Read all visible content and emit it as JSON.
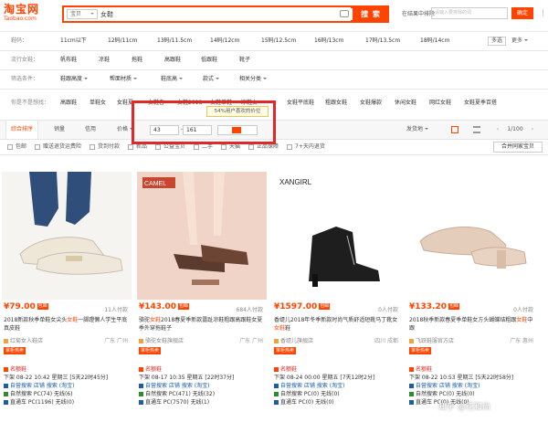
{
  "logo": {
    "line1": "淘宝网",
    "line2": "Taobao.com"
  },
  "search": {
    "scope": "宝贝",
    "value": "女鞋",
    "button": "搜 索",
    "in_result_label": "在结果中排除",
    "in_result_placeholder": "请输入要排除的词",
    "confirm": "确定"
  },
  "filters": {
    "size": {
      "label": "鞋码：",
      "items": [
        "11cm以下",
        "12码/11cm",
        "13码/11.5cm",
        "14码/12cm",
        "15码/12.5cm",
        "16码/13cm",
        "17码/13.5cm",
        "18码/14cm"
      ],
      "multi": "多选",
      "more": "更多"
    },
    "style": {
      "label": "流行女鞋：",
      "items": [
        "帆布鞋",
        "凉鞋",
        "拖鞋",
        "高跟鞋",
        "低跟鞋",
        "靴子"
      ]
    },
    "more_conditions": {
      "label": "筛选条件：",
      "items": [
        "鞋跟高度",
        "帮面材质",
        "鞋底高",
        "款式",
        "相关分类"
      ]
    },
    "maybe": {
      "label": "你是不是想找：",
      "items": [
        "高跟鞋",
        "单鞋女",
        "女鞋夏",
        "女鞋春",
        "女鞋2018",
        "女鞋单鞋",
        "凉鞋女",
        "女鞋平底鞋",
        "粗跟女鞋",
        "女鞋爆款",
        "休闲女鞋",
        "网红女鞋",
        "女鞋夏季百搭"
      ]
    }
  },
  "sort": {
    "items": [
      "综合排序",
      "销量",
      "信用",
      "价格"
    ],
    "price_from": "43",
    "price_to": "161",
    "shipping": "发货地",
    "view_pages": "1/100",
    "tip": "54%用户喜欢的价位"
  },
  "filter2": [
    "包邮",
    "赠送退货运费险",
    "货到付款",
    "新品",
    "公益宝贝",
    "二手",
    "天猫",
    "正品保障",
    "7+天内退货"
  ],
  "location": "合并同家宝贝",
  "products": [
    {
      "price": "¥79.00",
      "badge": "包邮",
      "paid": "11人付款",
      "title_pre": "2018新款秋季单鞋女尖头",
      "title_hl": "女鞋",
      "title_post": "一脚蹬懒人学生平底真皮鞋",
      "shop": "红菊女人鞋店",
      "city": "广东 广州",
      "tag": "掌柜热卖",
      "l1": "下架 08-22 10:42 星期三 [5天22时45分]",
      "l2": "自然搜索 PC(74) 无线(6)",
      "l3": "直通车 PC(1196) 无线(0)"
    },
    {
      "price": "¥143.00",
      "badge": "包邮",
      "paid": "684人付款",
      "title_pre": "骆驼",
      "title_hl": "女鞋",
      "title_post": "2018春夏季新款露趾凉鞋粗跟高跟鞋女夏季外穿拖鞋子",
      "shop": "骆驼女鞋旗舰店",
      "city": "广东 广州",
      "tag": "掌柜热卖",
      "l1": "下架 08-17 10:35 星期五 [22时37分]",
      "l2": "自然搜索 PC(471) 无线(32)",
      "l3": "直通车 PC(7570) 无线(1)"
    },
    {
      "price": "¥1597.00",
      "badge": "包邮",
      "paid": "0人付款",
      "title_pre": "香缇儿2018年冬季新款时尚气质舒适短靴马丁靴女",
      "title_hl": "女鞋",
      "title_post": "鞋",
      "shop": "香缇儿旗舰店",
      "city": "四川 成都",
      "tag": "掌柜热卖",
      "l1": "下架 08-24 00:00 星期五 [7天12时2分]",
      "l2": "自然搜索 PC(0) 无线(0)",
      "l3": "直通车 PC(0) 无线(0)"
    },
    {
      "price": "¥133.20",
      "badge": "包邮",
      "paid": "0人付款",
      "title_pre": "2018秋季新款春夏季单鞋女方头蝴蝶结粗跟",
      "title_hl": "女鞋",
      "title_post": "中跟",
      "shop": "飞跃鞋服官方店",
      "city": "广东 惠州",
      "tag": "掌柜热卖",
      "l1": "下架 08-22 10:53 星期三 [5天22时58分]",
      "l2": "自然搜索 PC(0) 无线(0)",
      "l3": "直通车 PC(0) 无线(0)"
    }
  ],
  "watermark": "知乎 @花和尚",
  "colors": {
    "accent": "#ff4400",
    "highlight": "#e02828",
    "link": "#1c5ea6"
  }
}
